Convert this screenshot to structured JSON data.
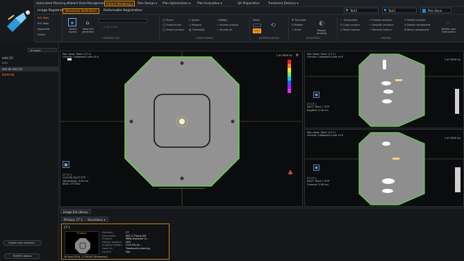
{
  "topbar": {
    "tabs": [
      "Automated Planning ▾",
      "Patient Data Management",
      "Patient Modeling ▾",
      "Plan Design ▾",
      "Plan Optimization ▾",
      "Plan Evaluation ▾",
      "QA Preparation",
      "Treatment Delivery ▾"
    ],
    "active_tab_index": 2,
    "patient_selector": "Test1",
    "plan_selector": "Test1",
    "plan_status": "Plan Done"
  },
  "subbar": {
    "tabs": [
      "Image Registration",
      "Structure Definition",
      "Deformable Registration"
    ],
    "active_index": 1
  },
  "ribbon": {
    "roi_tools": [
      "ROI Tools",
      "POI Tools",
      "Approved",
      "Fusion"
    ],
    "layout": {
      "select_label": "Select layout",
      "new_roi_label": "New ROI geometry"
    },
    "group_labels": [
      "CURRENT ROI",
      "CONTOURING",
      "INTERPOLATION",
      "SCULPTING",
      "EDITING"
    ],
    "contouring": [
      "Brush",
      "Smart brush",
      "Smart contour",
      "Spline",
      "Polygon",
      "Threshold",
      "Draw",
      "Accept contour",
      "Accept all"
    ],
    "mode_label": "Mode",
    "sculpting": [
      "Translate",
      "Rotate",
      "Scale",
      "Sculpt",
      "Region growing"
    ],
    "editing": [
      "Interpolate",
      "Copy contour",
      "Paste contour",
      "Counts removal",
      "Simplify contours",
      "Remove holes ▾",
      "Delete contour",
      "Delete component",
      "Move component",
      "Define user interaction"
    ]
  },
  "left_panel": {
    "search_label": "▾ Invert",
    "rows": [
      {
        "text": "ects (2)",
        "color": "#d6d6d6"
      },
      {
        "text": "ena",
        "color": "#9aa0a6"
      },
      {
        "text": "ans at risk (1)",
        "color": "#d6d6d6",
        "selected": true
      },
      {
        "text": "External",
        "color": "#ff8c1a"
      }
    ],
    "buttons": [
      "Create new material...",
      "ROI/POI details"
    ]
  },
  "viewports": {
    "main": {
      "title_lines": [
        "Plan dose: Test1 (CT 1)",
        "Clinical: Collapsed Cone v5.0"
      ],
      "info_lines": [
        "CT CT 1",
        "CLOUTA_RLUT STP",
        "Transversal: 0.00 cm",
        "Slice: 177/352"
      ],
      "scale_label": "1 of 2000 Gy",
      "scale_colors": [
        "#ff2020",
        "#ff8020",
        "#ffe020",
        "#60ff40",
        "#20c0ff",
        "#2060ff",
        "#a020ff",
        "#ff20ff"
      ]
    },
    "right_top": {
      "title_lines": [
        "Plan dose: Test1 (CT 1)",
        "Clinical: Collapsed Cone v5.0"
      ],
      "info_lines": [
        "CT CT 1",
        "DUCT Test1 T STP",
        "Sagittal: 0.00 cm"
      ],
      "scale_label": "1 of 2000 Gy"
    },
    "right_bottom": {
      "title_lines": [
        "Plan dose: Test1 (CT 1)",
        "Clinical: Collapsed Cone v5.0"
      ],
      "info_lines": [
        "CT CT 1",
        "DUCT Test1 T STP",
        "Coronal: 0.00 cm"
      ],
      "scale_label": "1 of 2000 Gy"
    }
  },
  "bottom": {
    "title": "Image Set Library",
    "tabs": [
      "Primary: CT 1",
      "Secondary: ▾"
    ],
    "card": {
      "title": "CT 1",
      "badge": "Primary",
      "fields": [
        {
          "k": "Modality",
          "v": "CT"
        },
        {
          "k": "Description",
          "v": "SBT 2,Tissue 0M"
        },
        {
          "k": "Protocol",
          "v": "MBN standard 2/..."
        },
        {
          "k": "Patient position",
          "v": "HFS"
        },
        {
          "k": "Imaging system",
          "v": "CLOUTA_RL..."
        },
        {
          "k": "Used for",
          "v": "Treatment planning"
        },
        {
          "k": "Explicit",
          "v": "N/A"
        }
      ],
      "footer": "26 Aug 2018, 17:58:00 (Summary)"
    }
  }
}
